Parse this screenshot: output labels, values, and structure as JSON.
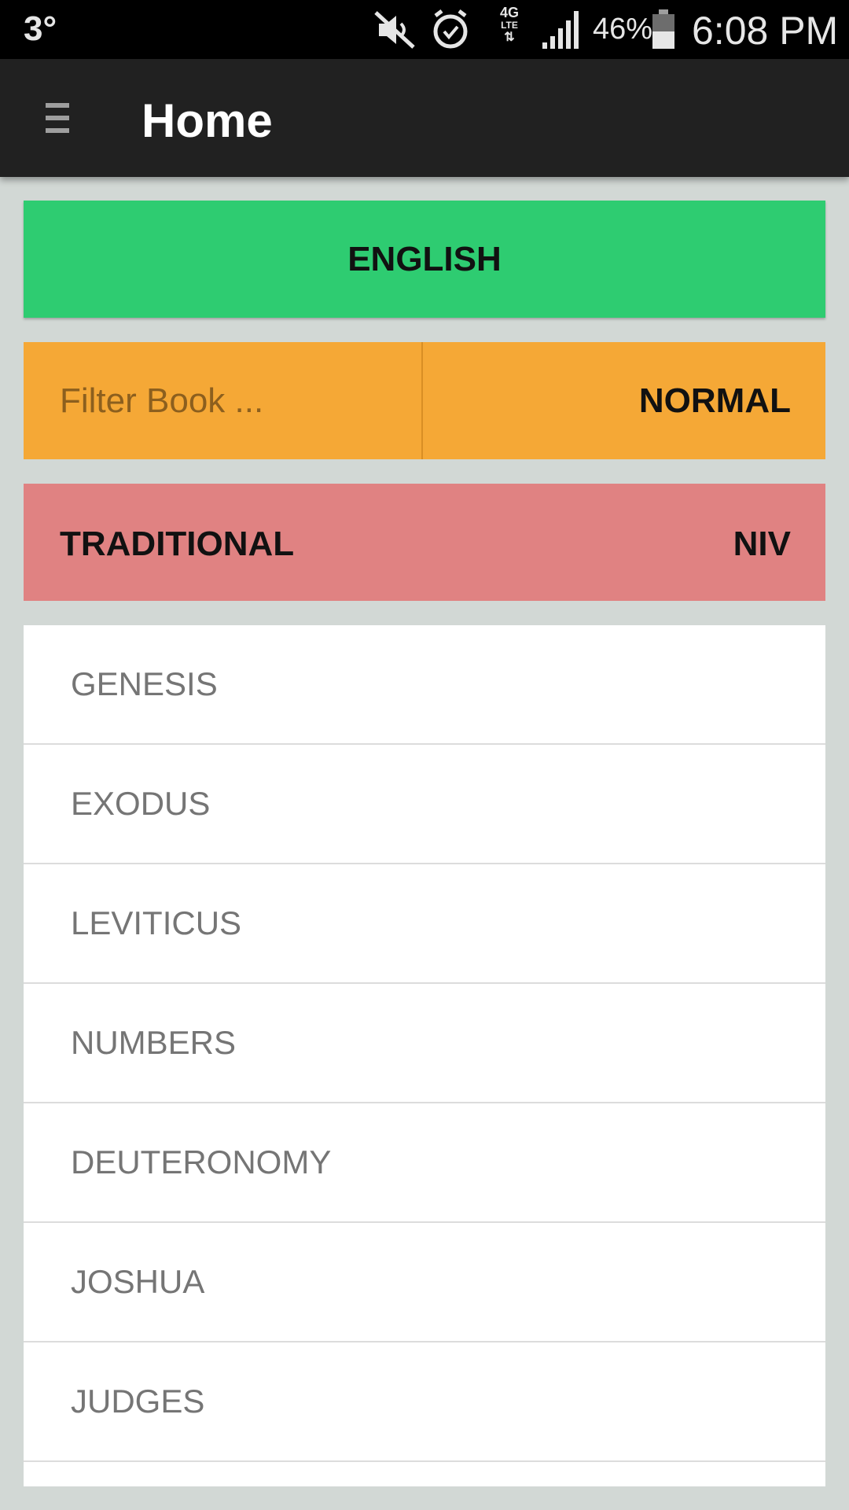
{
  "status_bar": {
    "temperature": "3°",
    "network": "4G LTE",
    "battery": "46%",
    "time": "6:08 PM",
    "icons": [
      "mute-icon",
      "alarm-icon",
      "lte-icon",
      "signal-icon",
      "battery-icon"
    ]
  },
  "app_bar": {
    "title": "Home",
    "menu_icon": "hamburger-menu-icon"
  },
  "controls": {
    "language": "ENGLISH",
    "filter_placeholder": "Filter Book ...",
    "filter_value": "",
    "mode": "NORMAL",
    "order": "TRADITIONAL",
    "version": "NIV"
  },
  "books": [
    {
      "name": "GENESIS"
    },
    {
      "name": "EXODUS"
    },
    {
      "name": "LEVITICUS"
    },
    {
      "name": "NUMBERS"
    },
    {
      "name": "DEUTERONOMY"
    },
    {
      "name": "JOSHUA"
    },
    {
      "name": "JUDGES"
    }
  ],
  "colors": {
    "language_button": "#2ecc71",
    "filter_row": "#f5a836",
    "version_row": "#e08282",
    "app_bar": "#212121",
    "background": "#d2d8d5"
  }
}
